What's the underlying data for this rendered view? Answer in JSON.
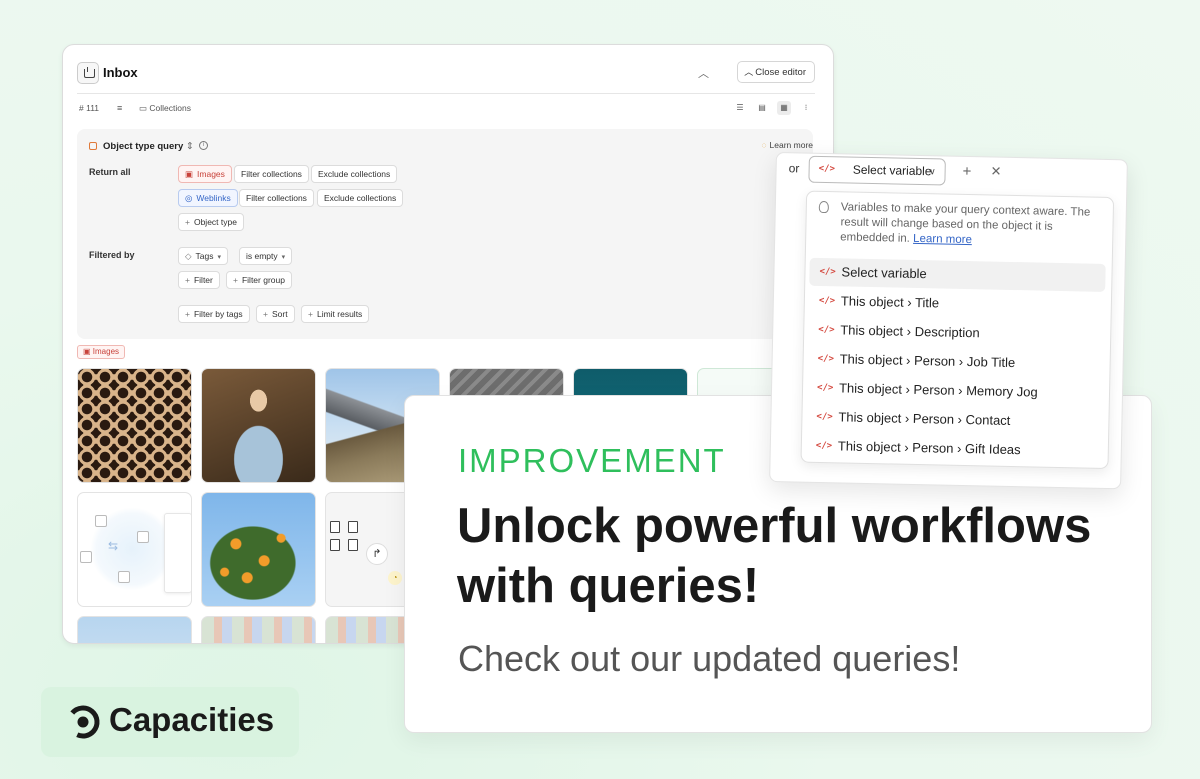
{
  "editor": {
    "title": "Inbox",
    "close_label": "Close editor",
    "count": "111",
    "collections_label": "Collections",
    "query": {
      "type_label": "Object type query",
      "learn_more": "Learn more",
      "return_all_label": "Return all",
      "rows": [
        {
          "type": "Images",
          "filter": "Filter collections",
          "exclude": "Exclude collections"
        },
        {
          "type": "Weblinks",
          "filter": "Filter collections",
          "exclude": "Exclude collections"
        }
      ],
      "object_type_button": "Object type",
      "filtered_by_label": "Filtered by",
      "tag_field": "Tags",
      "tag_condition": "is empty",
      "filter_button": "Filter",
      "filter_group_button": "Filter group",
      "filter_by_tags_button": "Filter by tags",
      "sort_button": "Sort",
      "limit_button": "Limit results"
    },
    "section_tag": "Images"
  },
  "promo": {
    "tag": "IMPROVEMENT",
    "title": "Unlock powerful workflows with queries!",
    "subtitle": "Check out our updated queries!"
  },
  "brand": {
    "name": "Capacities",
    "accent": "#2fbf5c"
  },
  "variable_picker": {
    "or_label": "or",
    "select_label": "Select variable",
    "hint": "Variables to make your query context aware. The result will change based on the object it is embedded in.",
    "hint_link": "Learn more",
    "options": [
      "Select variable",
      "This object › Title",
      "This object › Description",
      "This object › Person › Job Title",
      "This object › Person › Memory Jog",
      "This object › Person › Contact",
      "This object › Person › Gift Ideas"
    ]
  },
  "colors": {
    "background": "#eaf8ee",
    "code_icon": "#d4493f",
    "link": "#3566c7"
  }
}
